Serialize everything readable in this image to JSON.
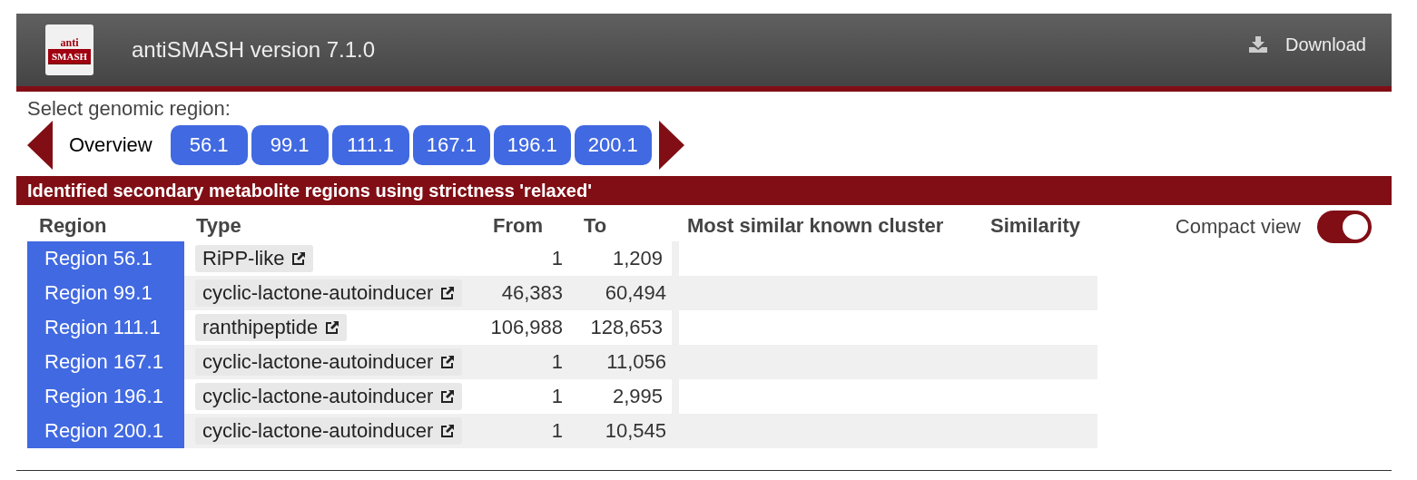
{
  "header": {
    "logo": {
      "top": "anti",
      "bottom": "SMASH"
    },
    "title": "antiSMASH version 7.1.0",
    "download": "Download"
  },
  "region_nav": {
    "label": "Select genomic region:",
    "items": [
      {
        "label": "Overview",
        "selected": true
      },
      {
        "label": "56.1",
        "selected": false
      },
      {
        "label": "99.1",
        "selected": false
      },
      {
        "label": "111.1",
        "selected": false
      },
      {
        "label": "167.1",
        "selected": false
      },
      {
        "label": "196.1",
        "selected": false
      },
      {
        "label": "200.1",
        "selected": false
      }
    ]
  },
  "overview": {
    "title": "Identified secondary metabolite regions using strictness 'relaxed'",
    "columns": [
      "Region",
      "Type",
      "From",
      "To",
      "Most similar known cluster",
      "Similarity"
    ],
    "compact_view": {
      "label": "Compact view",
      "on": true
    },
    "rows": [
      {
        "region": "Region 56.1",
        "type": "RiPP-like",
        "from": "1",
        "to": "1,209"
      },
      {
        "region": "Region 99.1",
        "type": "cyclic-lactone-autoinducer",
        "from": "46,383",
        "to": "60,494"
      },
      {
        "region": "Region 111.1",
        "type": "ranthipeptide",
        "from": "106,988",
        "to": "128,653"
      },
      {
        "region": "Region 167.1",
        "type": "cyclic-lactone-autoinducer",
        "from": "1",
        "to": "11,056"
      },
      {
        "region": "Region 196.1",
        "type": "cyclic-lactone-autoinducer",
        "from": "1",
        "to": "2,995"
      },
      {
        "region": "Region 200.1",
        "type": "cyclic-lactone-autoinducer",
        "from": "1",
        "to": "10,545"
      }
    ]
  }
}
